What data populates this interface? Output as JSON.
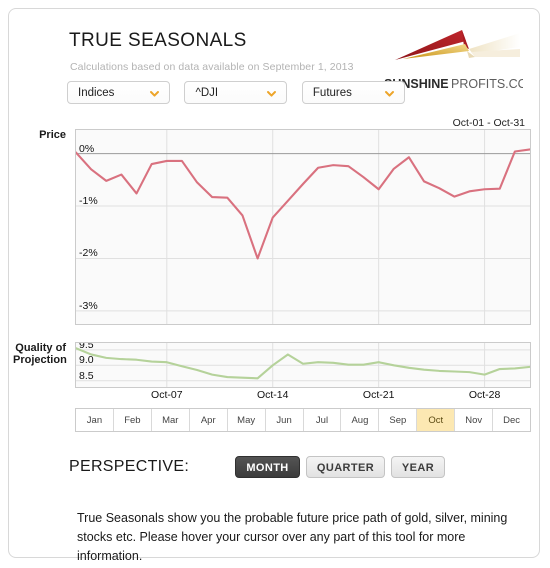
{
  "header": {
    "title": "TRUE SEASONALS",
    "subtitle": "Calculations based on data available on September 1, 2013",
    "logo": {
      "brand_bold": "SUNSHINE",
      "brand_light": " PROFITS.COM",
      "color_red": "#a81c23",
      "color_gold": "#d9a01e"
    }
  },
  "filters": [
    {
      "name": "market-type",
      "value": "Indices",
      "icon": "chevron-down-icon"
    },
    {
      "name": "symbol",
      "value": "^DJI",
      "icon": "chevron-down-icon"
    },
    {
      "name": "instrument",
      "value": "Futures",
      "icon": "chevron-down-icon"
    }
  ],
  "price_chart": {
    "axis_title": "Price",
    "date_range": "Oct-01 - Oct-31",
    "y_ticks": [
      "0%",
      "-1%",
      "-2%",
      "-3%"
    ],
    "line_color": "#d9717f"
  },
  "quality_chart": {
    "axis_title_line1": "Quality of",
    "axis_title_line2": "Projection",
    "y_ticks": [
      "9.5",
      "9.0",
      "8.5"
    ],
    "line_color": "#b5d29a"
  },
  "x_ticks": [
    "Oct-07",
    "Oct-14",
    "Oct-21",
    "Oct-28"
  ],
  "months": [
    {
      "label": "Jan",
      "active": false
    },
    {
      "label": "Feb",
      "active": false
    },
    {
      "label": "Mar",
      "active": false
    },
    {
      "label": "Apr",
      "active": false
    },
    {
      "label": "May",
      "active": false
    },
    {
      "label": "Jun",
      "active": false
    },
    {
      "label": "Jul",
      "active": false
    },
    {
      "label": "Aug",
      "active": false
    },
    {
      "label": "Sep",
      "active": false
    },
    {
      "label": "Oct",
      "active": true
    },
    {
      "label": "Nov",
      "active": false
    },
    {
      "label": "Dec",
      "active": false
    }
  ],
  "perspective": {
    "label": "PERSPECTIVE:",
    "options": [
      {
        "label": "MONTH",
        "active": true
      },
      {
        "label": "QUARTER",
        "active": false
      },
      {
        "label": "YEAR",
        "active": false
      }
    ]
  },
  "footer_text": "True Seasonals show you the probable future price path of gold, silver, mining stocks etc. Please hover your cursor over any part of this tool for more information.",
  "chart_data": [
    {
      "type": "line",
      "title": "Price",
      "subtitle": "Oct-01 - Oct-31",
      "xlabel": "",
      "ylabel": "Price",
      "ylim": [
        -3.25,
        0.45
      ],
      "ytick_values": [
        0,
        -1,
        -2,
        -3
      ],
      "ytick_labels": [
        "0%",
        "-1%",
        "-2%",
        "-3%"
      ],
      "grid": true,
      "legend": "none",
      "x": [
        "Oct-01",
        "Oct-02",
        "Oct-03",
        "Oct-04",
        "Oct-05",
        "Oct-06",
        "Oct-07",
        "Oct-08",
        "Oct-09",
        "Oct-10",
        "Oct-11",
        "Oct-12",
        "Oct-13",
        "Oct-14",
        "Oct-15",
        "Oct-16",
        "Oct-17",
        "Oct-18",
        "Oct-19",
        "Oct-20",
        "Oct-21",
        "Oct-22",
        "Oct-23",
        "Oct-24",
        "Oct-25",
        "Oct-26",
        "Oct-27",
        "Oct-28",
        "Oct-29",
        "Oct-30",
        "Oct-31"
      ],
      "xtick_labels": [
        "Oct-07",
        "Oct-14",
        "Oct-21",
        "Oct-28"
      ],
      "values": [
        0.02,
        -0.3,
        -0.52,
        -0.4,
        -0.76,
        -0.2,
        -0.14,
        -0.14,
        -0.55,
        -0.83,
        -0.84,
        -1.18,
        -2.0,
        -1.22,
        -0.9,
        -0.58,
        -0.27,
        -0.22,
        -0.24,
        -0.45,
        -0.68,
        -0.29,
        -0.07,
        -0.53,
        -0.66,
        -0.82,
        -0.72,
        -0.68,
        -0.67,
        0.04,
        0.08
      ],
      "series_color": "#d9717f"
    },
    {
      "type": "line",
      "title": "Quality of Projection",
      "xlabel": "",
      "ylabel": "Quality of Projection",
      "ylim": [
        8.3,
        9.72
      ],
      "ytick_values": [
        9.5,
        9.0,
        8.5
      ],
      "ytick_labels": [
        "9.5",
        "9.0",
        "8.5"
      ],
      "grid": true,
      "legend": "none",
      "x": [
        "Oct-01",
        "Oct-02",
        "Oct-03",
        "Oct-04",
        "Oct-05",
        "Oct-06",
        "Oct-07",
        "Oct-08",
        "Oct-09",
        "Oct-10",
        "Oct-11",
        "Oct-12",
        "Oct-13",
        "Oct-14",
        "Oct-15",
        "Oct-16",
        "Oct-17",
        "Oct-18",
        "Oct-19",
        "Oct-20",
        "Oct-21",
        "Oct-22",
        "Oct-23",
        "Oct-24",
        "Oct-25",
        "Oct-26",
        "Oct-27",
        "Oct-28",
        "Oct-29",
        "Oct-30",
        "Oct-31"
      ],
      "xtick_labels": [
        "Oct-07",
        "Oct-14",
        "Oct-21",
        "Oct-28"
      ],
      "values": [
        9.55,
        9.35,
        9.24,
        9.2,
        9.18,
        9.12,
        9.1,
        8.97,
        8.85,
        8.7,
        8.62,
        8.6,
        8.58,
        9.0,
        9.35,
        9.05,
        9.1,
        9.08,
        9.02,
        9.02,
        9.1,
        9.0,
        8.92,
        8.86,
        8.82,
        8.8,
        8.78,
        8.7,
        8.88,
        8.9,
        8.95
      ],
      "series_color": "#b5d29a"
    }
  ]
}
